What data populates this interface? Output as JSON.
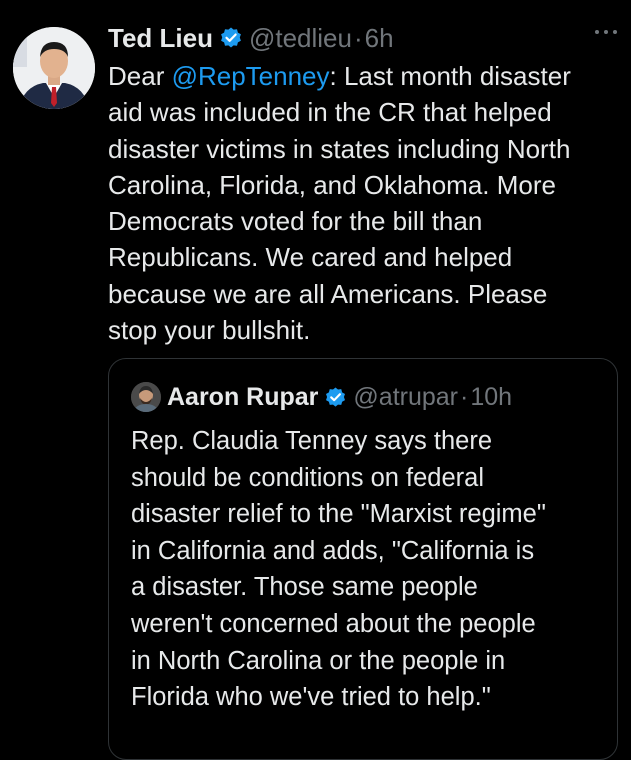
{
  "colors": {
    "background": "#000000",
    "text": "#e7e9ea",
    "muted": "#71767b",
    "link": "#1d9bf0",
    "verified": "#1d9bf0",
    "border": "#2f3336"
  },
  "tweet": {
    "author_name": "Ted Lieu",
    "verified_icon": "verified-badge-icon",
    "handle": "@tedlieu",
    "separator": "·",
    "time": "6h",
    "more_icon": "more-options-icon",
    "body": {
      "line1_prefix": "Dear ",
      "mention": "@RepTenney",
      "line1_suffix": ": Last month disaster",
      "lines": [
        "aid was included in the CR that helped",
        "disaster victims in states including North",
        "Carolina, Florida, and Oklahoma. More",
        "Democrats voted for the bill than",
        "Republicans. We cared and helped",
        "because we are all Americans. Please",
        "stop your bullshit."
      ]
    },
    "quoted": {
      "author_name": "Aaron Rupar",
      "handle": "@atrupar",
      "separator": "·",
      "time": "10h",
      "lines": [
        "Rep. Claudia Tenney says there",
        "should be conditions on federal",
        "disaster relief to the \"Marxist regime\"",
        "in California and adds, \"California is",
        "a disaster. Those same people",
        "weren't concerned about the people",
        "in North Carolina or the people in",
        "Florida who we've tried to help.\""
      ]
    }
  }
}
